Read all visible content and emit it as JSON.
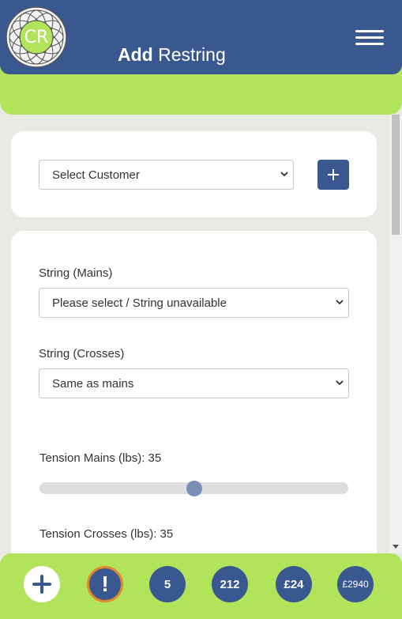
{
  "header": {
    "logo_text": "CR",
    "title_bold": "Add",
    "title_rest": " Restring"
  },
  "customer": {
    "select_value": "Select Customer"
  },
  "string": {
    "mains_label": "String (Mains)",
    "mains_value": "Please select / String unavailable",
    "crosses_label": "String (Crosses)",
    "crosses_value": "Same as mains"
  },
  "tension": {
    "mains_label": "Tension Mains (lbs): 35",
    "mains_value": 35,
    "mains_fraction": 0.5,
    "crosses_label": "Tension Crosses (lbs): 35"
  },
  "footer": {
    "alert_label": "!",
    "count_label": "5",
    "total_label": "212",
    "amount_label": "£24",
    "revenue_label": "£2940"
  },
  "colors": {
    "primary": "#3a5890",
    "accent": "#b1e35b",
    "alert_ring": "#e0892c"
  }
}
